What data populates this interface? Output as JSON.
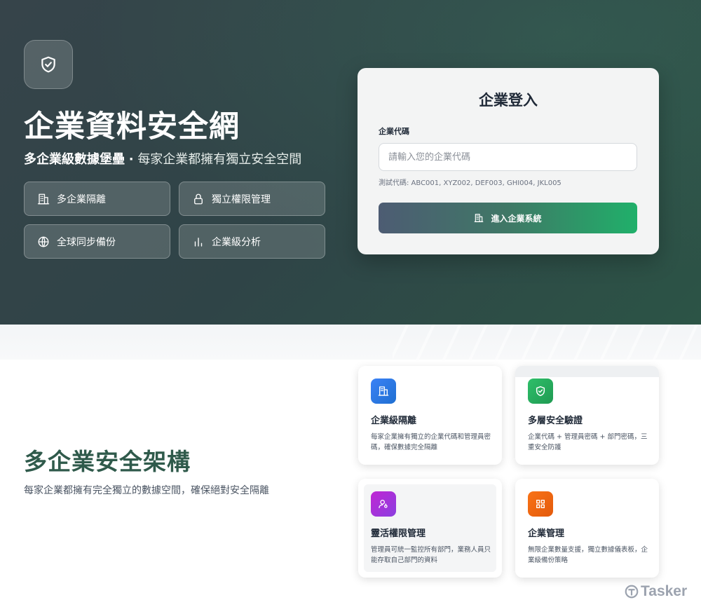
{
  "hero": {
    "title": "企業資料安全網",
    "subtitle_strong": "多企業級數據堡壘",
    "subtitle_separator": "·",
    "subtitle_rest": "每家企業都擁有獨立安全空間",
    "features": [
      {
        "label": "多企業隔離",
        "icon": "building-icon"
      },
      {
        "label": "獨立權限管理",
        "icon": "lock-icon"
      },
      {
        "label": "全球同步備份",
        "icon": "globe-icon"
      },
      {
        "label": "企業級分析",
        "icon": "bar-chart-icon"
      }
    ]
  },
  "login": {
    "title": "企業登入",
    "code_label": "企業代碼",
    "code_placeholder": "請輸入您的企業代碼",
    "code_value": "",
    "hint": "測試代碼: ABC001, XYZ002, DEF003, GHI004, JKL005",
    "submit_label": "進入企業系統"
  },
  "section": {
    "title": "多企業安全架構",
    "description": "每家企業都擁有完全獨立的數據空間，確保絕對安全隔離",
    "cards": [
      {
        "title": "企業級隔離",
        "description": "每家企業擁有獨立的企業代碼和管理員密碼，確保數據完全隔離",
        "icon": "building-icon",
        "color": "#2f7fd8"
      },
      {
        "title": "多層安全驗證",
        "description": "企業代碼 + 管理員密碼 + 部門密碼，三重安全防護",
        "icon": "shield-check-icon",
        "color": "#22a25a"
      },
      {
        "title": "靈活權限管理",
        "description": "管理員可統一監控所有部門，業務人員只能存取自己部門的資料",
        "icon": "user-key-icon",
        "color": "#b43fd6"
      },
      {
        "title": "企業管理",
        "description": "無限企業數量支援，獨立數據儀表板，企業級備份策略",
        "icon": "grid-icon",
        "color": "#f06b12"
      }
    ]
  },
  "watermark": {
    "text": "Tasker"
  },
  "colors": {
    "accent_green": "#22a25a",
    "heading_green": "#2f5a4b",
    "hero_bg": "#32464a"
  }
}
